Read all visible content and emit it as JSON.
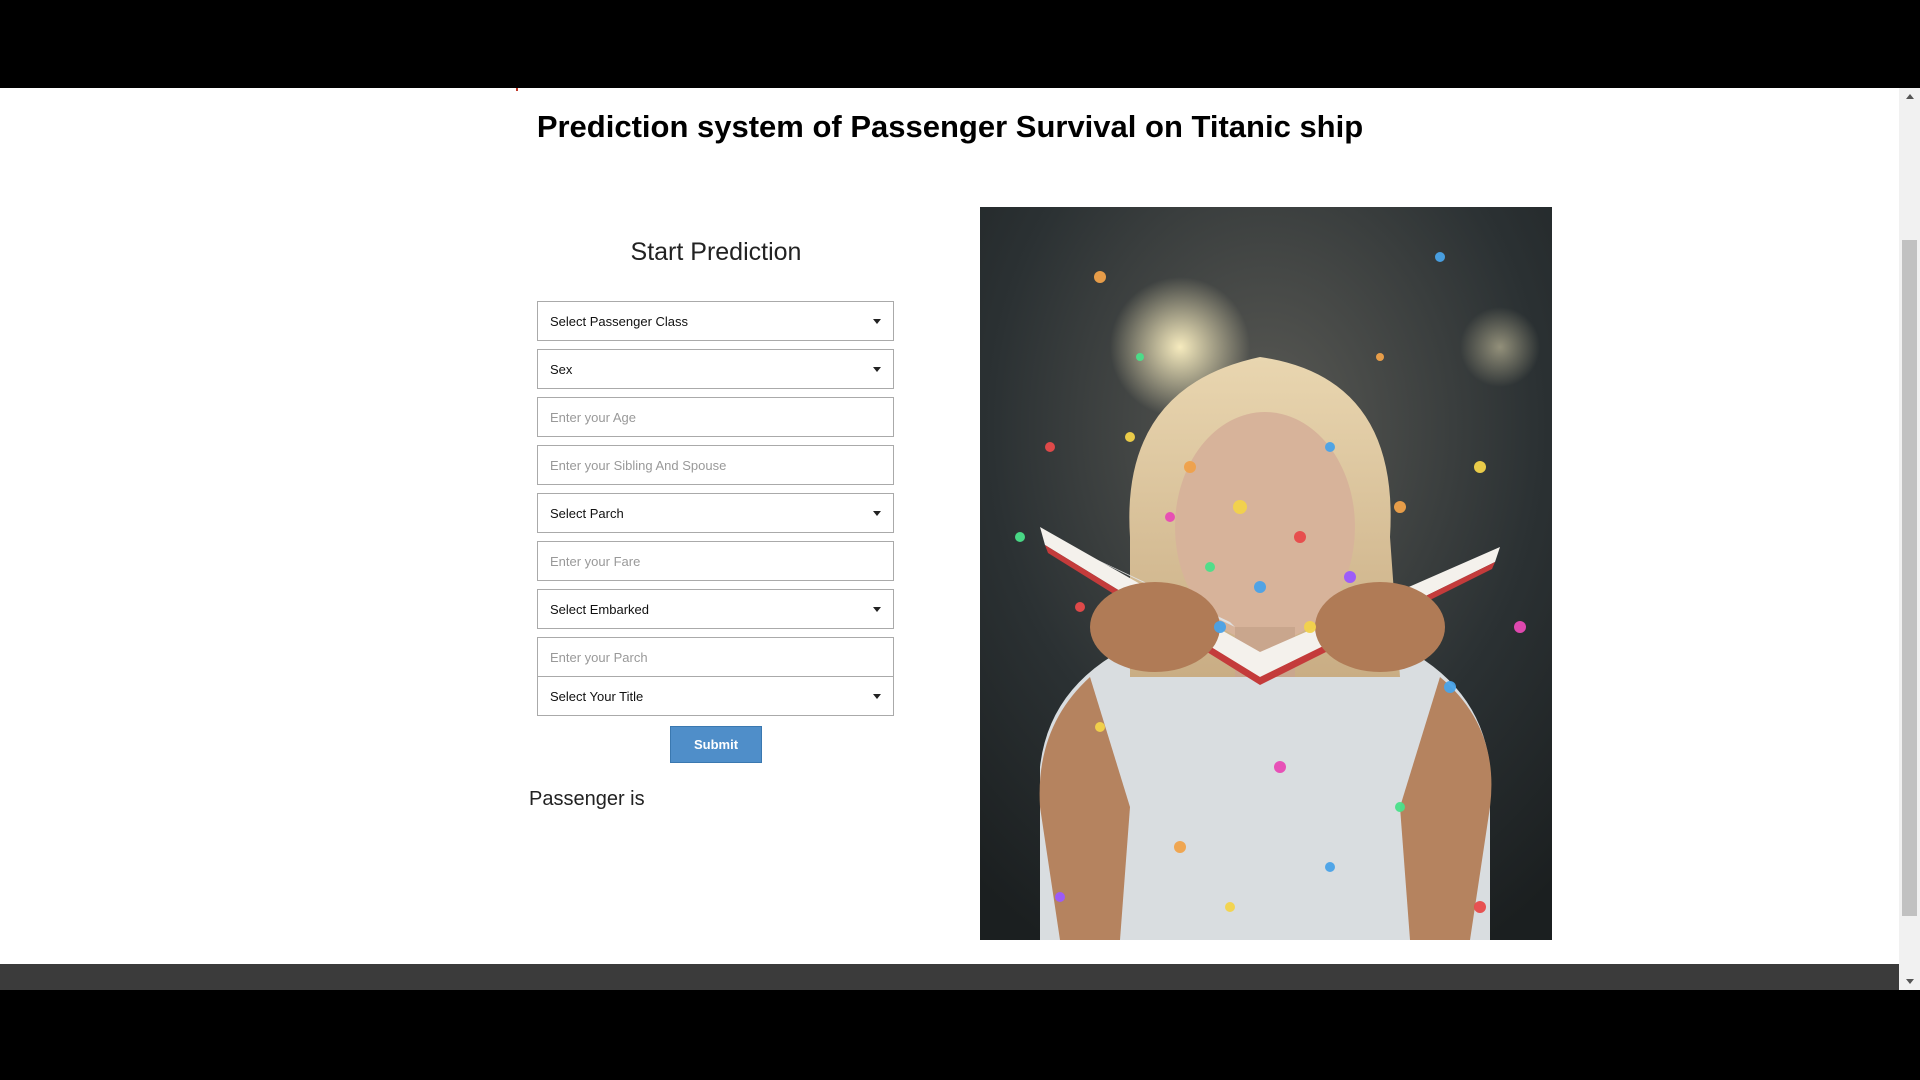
{
  "page": {
    "title": "Prediction system of Passenger Survival on Titanic ship",
    "form_heading": "Start Prediction",
    "result_label": "Passenger is"
  },
  "form": {
    "passenger_class": "Select Passenger Class",
    "sex": "Sex",
    "age_placeholder": "Enter your Age",
    "sibling_spouse_placeholder": "Enter your Sibling And Spouse",
    "parch_select": "Select Parch",
    "fare_placeholder": "Enter your Fare",
    "embarked": "Select Embarked",
    "parch_placeholder": "Enter your Parch",
    "title_select": "Select Your Title",
    "submit_label": "Submit"
  },
  "colors": {
    "submit_button": "#4f8ec9",
    "footer_bar": "#3b3b3b"
  },
  "icons": [
    "chevron-down-icon",
    "scroll-up-arrow-icon",
    "scroll-down-arrow-icon"
  ]
}
